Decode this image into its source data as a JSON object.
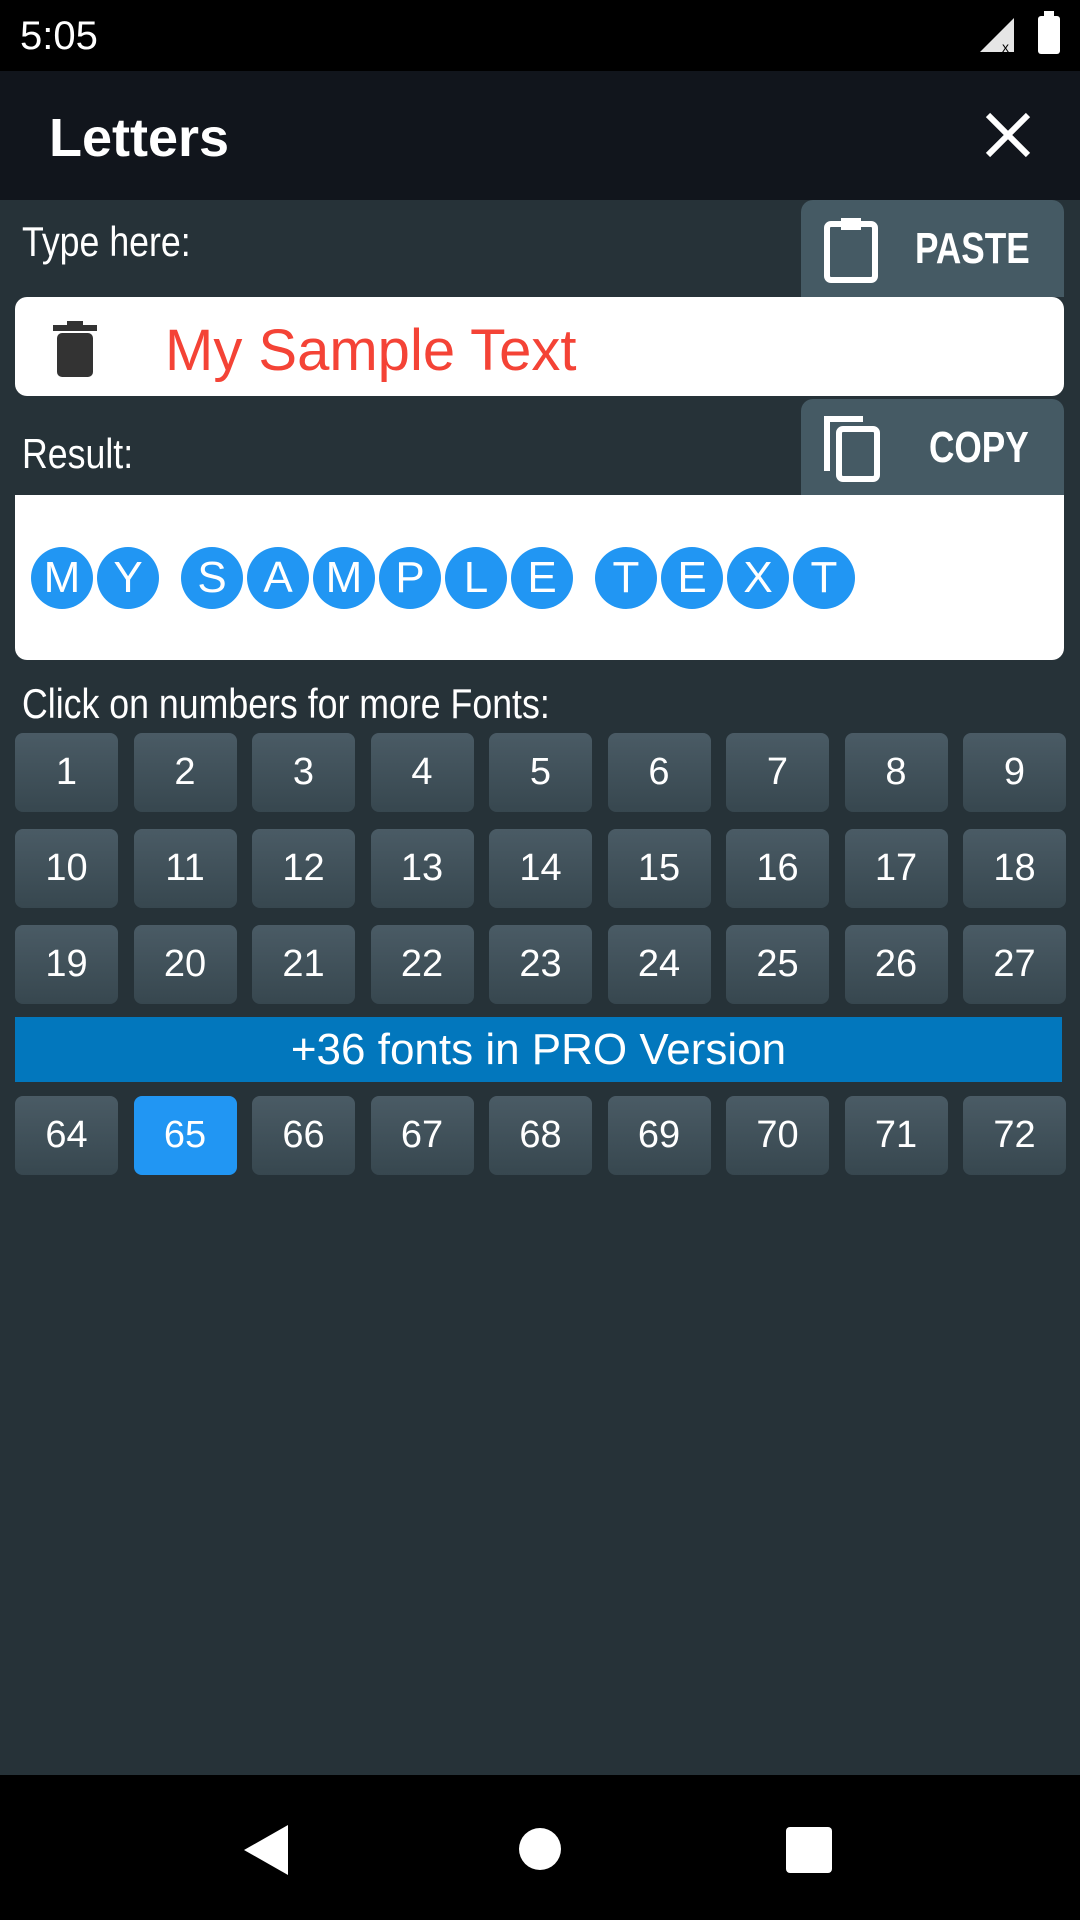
{
  "status_bar": {
    "time": "5:05",
    "icons": [
      "signal-icon",
      "battery-icon"
    ]
  },
  "app_bar": {
    "title": "Letters",
    "close_icon": "close-icon"
  },
  "input_section": {
    "label": "Type here:",
    "paste_label": "PASTE",
    "value": "My Sample Text",
    "text_color": "#f44336"
  },
  "result_section": {
    "label": "Result:",
    "copy_label": "COPY",
    "words": [
      [
        "M",
        "Y"
      ],
      [
        "S",
        "A",
        "M",
        "P",
        "L",
        "E"
      ],
      [
        "T",
        "E",
        "X",
        "T"
      ]
    ],
    "circle_color": "#2196f3"
  },
  "fonts": {
    "label": "Click on numbers for more Fonts:",
    "rows": [
      [
        "1",
        "2",
        "3",
        "4",
        "5",
        "6",
        "7",
        "8",
        "9"
      ],
      [
        "10",
        "11",
        "12",
        "13",
        "14",
        "15",
        "16",
        "17",
        "18"
      ],
      [
        "19",
        "20",
        "21",
        "22",
        "23",
        "24",
        "25",
        "26",
        "27"
      ]
    ],
    "pro_banner": "+36 fonts in PRO Version",
    "pro_row": [
      "64",
      "65",
      "66",
      "67",
      "68",
      "69",
      "70",
      "71",
      "72"
    ],
    "selected": "65"
  },
  "colors": {
    "background": "#263238",
    "app_bar": "#11151c",
    "button": "#455a64",
    "pro": "#0277bd",
    "accent": "#2196f3"
  }
}
